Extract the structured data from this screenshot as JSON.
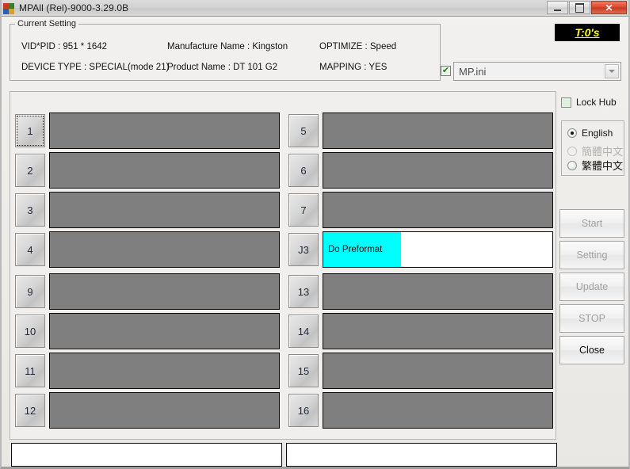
{
  "window": {
    "title": "MPAll (Rel)-9000-3.29.0B",
    "icon": "app-blocks-icon",
    "buttons": {
      "minimize": "minimize",
      "maximize": "maximize",
      "close": "close"
    }
  },
  "current_setting": {
    "legend": "Current Setting",
    "fields": [
      {
        "label": "VID*PID :  951 * 1642"
      },
      {
        "label": "Manufacture Name : Kingston"
      },
      {
        "label": "OPTIMIZE : Speed"
      },
      {
        "label": "DEVICE TYPE : SPECIAL(mode 21)"
      },
      {
        "label": "Product Name : DT 101 G2"
      },
      {
        "label": "MAPPING : YES"
      }
    ]
  },
  "counter": {
    "text": "T:0's",
    "fg": "#ffff00",
    "bg": "#000000"
  },
  "ini": {
    "checked": true,
    "value": "MP.ini"
  },
  "slots": {
    "left": [
      {
        "id": "1",
        "state": "idle",
        "focused": true,
        "text": "",
        "progress": 0
      },
      {
        "id": "2",
        "state": "idle",
        "focused": false,
        "text": "",
        "progress": 0
      },
      {
        "id": "3",
        "state": "idle",
        "focused": false,
        "text": "",
        "progress": 0
      },
      {
        "id": "4",
        "state": "idle",
        "focused": false,
        "text": "",
        "progress": 0
      },
      {
        "id": "9",
        "state": "idle",
        "focused": false,
        "text": "",
        "progress": 0
      },
      {
        "id": "10",
        "state": "idle",
        "focused": false,
        "text": "",
        "progress": 0
      },
      {
        "id": "11",
        "state": "idle",
        "focused": false,
        "text": "",
        "progress": 0
      },
      {
        "id": "12",
        "state": "idle",
        "focused": false,
        "text": "",
        "progress": 0
      }
    ],
    "right": [
      {
        "id": "5",
        "state": "idle",
        "focused": false,
        "text": "",
        "progress": 0
      },
      {
        "id": "6",
        "state": "idle",
        "focused": false,
        "text": "",
        "progress": 0
      },
      {
        "id": "7",
        "state": "idle",
        "focused": false,
        "text": "",
        "progress": 0
      },
      {
        "id": "J3",
        "state": "active",
        "focused": false,
        "text": "Do Preformat",
        "progress": 34
      },
      {
        "id": "13",
        "state": "idle",
        "focused": false,
        "text": "",
        "progress": 0
      },
      {
        "id": "14",
        "state": "idle",
        "focused": false,
        "text": "",
        "progress": 0
      },
      {
        "id": "15",
        "state": "idle",
        "focused": false,
        "text": "",
        "progress": 0
      },
      {
        "id": "16",
        "state": "idle",
        "focused": false,
        "text": "",
        "progress": 0
      }
    ],
    "idle_color": "#7f7f7f",
    "active_color": "#00ffff"
  },
  "lock_hub": {
    "label": "Lock Hub",
    "checked": false
  },
  "language": {
    "options": [
      {
        "label": "English",
        "selected": true,
        "disabled": false
      },
      {
        "label": "簡體中文",
        "selected": false,
        "disabled": true
      },
      {
        "label": "繁體中文",
        "selected": false,
        "disabled": false
      }
    ]
  },
  "actions": [
    {
      "label": "Start",
      "enabled": false
    },
    {
      "label": "Setting",
      "enabled": false
    },
    {
      "label": "Update",
      "enabled": false
    },
    {
      "label": "STOP",
      "enabled": false
    },
    {
      "label": "Close",
      "enabled": true
    }
  ],
  "logs": {
    "left": "",
    "right": ""
  }
}
